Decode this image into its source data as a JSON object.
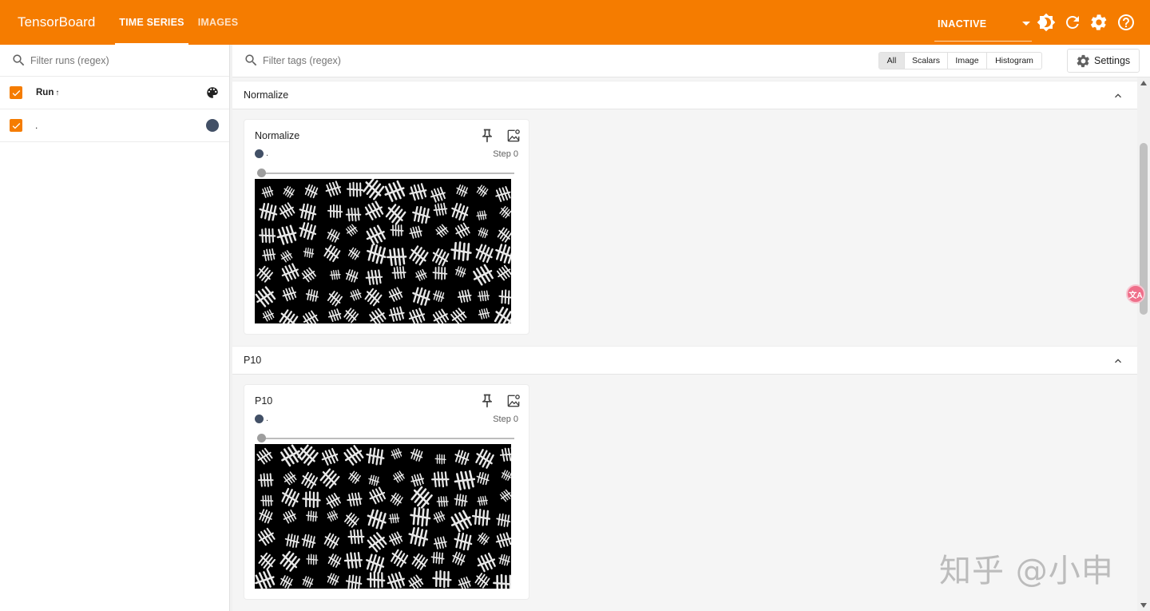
{
  "app": {
    "title": "TensorBoard"
  },
  "nav": {
    "tabs": [
      {
        "label": "TIME SERIES",
        "active": true
      },
      {
        "label": "IMAGES",
        "active": false
      }
    ],
    "status": "INACTIVE",
    "icons": [
      "brightness-icon",
      "refresh-icon",
      "settings-gear-icon",
      "help-icon"
    ]
  },
  "colors": {
    "brand": "#f57c00",
    "run": "#425066"
  },
  "sidebar": {
    "filter_placeholder": "Filter runs (regex)",
    "header_label": "Run",
    "sort_indicator": "↑",
    "runs": [
      {
        "name": ".",
        "checked": true
      }
    ]
  },
  "main": {
    "filter_placeholder": "Filter tags (regex)",
    "type_filters": [
      {
        "label": "All",
        "active": true
      },
      {
        "label": "Scalars",
        "active": false
      },
      {
        "label": "Image",
        "active": false
      },
      {
        "label": "Histogram",
        "active": false
      }
    ],
    "settings_label": "Settings",
    "groups": [
      {
        "name": "Normalize",
        "card": {
          "title": "Normalize",
          "run": ".",
          "step": "Step 0"
        }
      },
      {
        "name": "P10",
        "card": {
          "title": "P10",
          "run": ".",
          "step": "Step 0"
        }
      }
    ]
  },
  "watermark": "知乎 @小申"
}
